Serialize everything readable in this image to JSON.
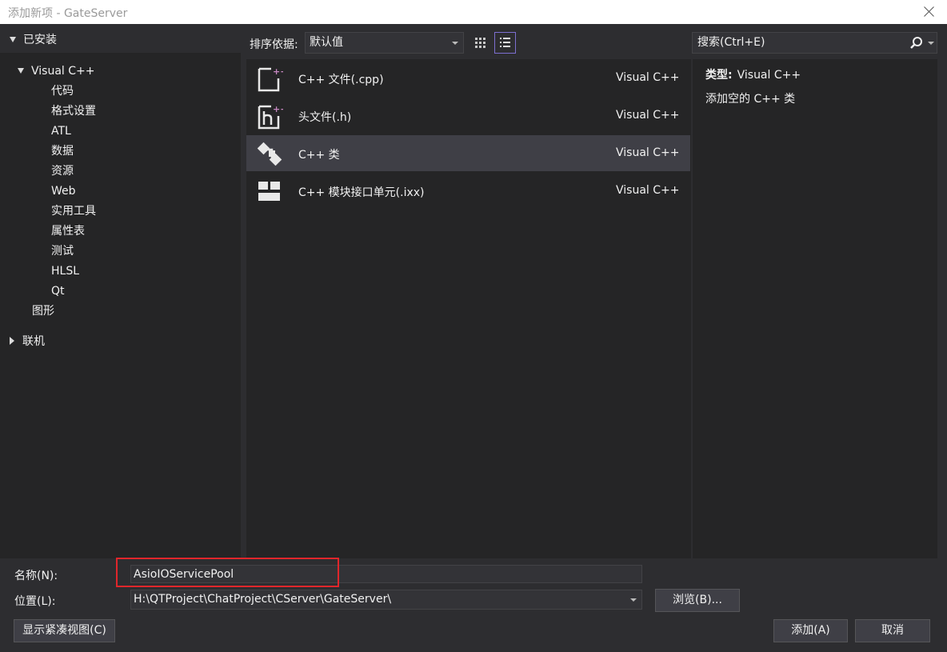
{
  "window": {
    "title": "添加新项 - GateServer"
  },
  "tree": {
    "installed": "已安装",
    "visual_cpp": "Visual C++",
    "children": [
      "代码",
      "格式设置",
      "ATL",
      "数据",
      "资源",
      "Web",
      "实用工具",
      "属性表",
      "测试",
      "HLSL",
      "Qt"
    ],
    "graphics": "图形",
    "online": "联机"
  },
  "toolbar": {
    "sort_label": "排序依据:",
    "sort_value": "默认值",
    "search_placeholder": "搜索(Ctrl+E)"
  },
  "templates": [
    {
      "name": "C++ 文件(.cpp)",
      "lang": "Visual C++",
      "icon": "cpp-file-icon",
      "selected": false
    },
    {
      "name": "头文件(.h)",
      "lang": "Visual C++",
      "icon": "header-file-icon",
      "selected": false
    },
    {
      "name": "C++ 类",
      "lang": "Visual C++",
      "icon": "cpp-class-icon",
      "selected": true
    },
    {
      "name": "C++ 模块接口单元(.ixx)",
      "lang": "Visual C++",
      "icon": "module-icon",
      "selected": false
    }
  ],
  "detail": {
    "type_label": "类型:",
    "type_value": "Visual C++",
    "description": "添加空的 C++ 类"
  },
  "form": {
    "name_label": "名称(N):",
    "name_value": "AsioIOServicePool",
    "location_label": "位置(L):",
    "location_value": "H:\\QTProject\\ChatProject\\CServer\\GateServer\\",
    "browse_label": "浏览(B)...",
    "compact_label": "显示紧凑视图(C)",
    "add_label": "添加(A)",
    "cancel_label": "取消"
  },
  "colors": {
    "accent": "#7d6fd0",
    "highlight_border": "#e0262b",
    "icon_purple": "#c586c0"
  }
}
